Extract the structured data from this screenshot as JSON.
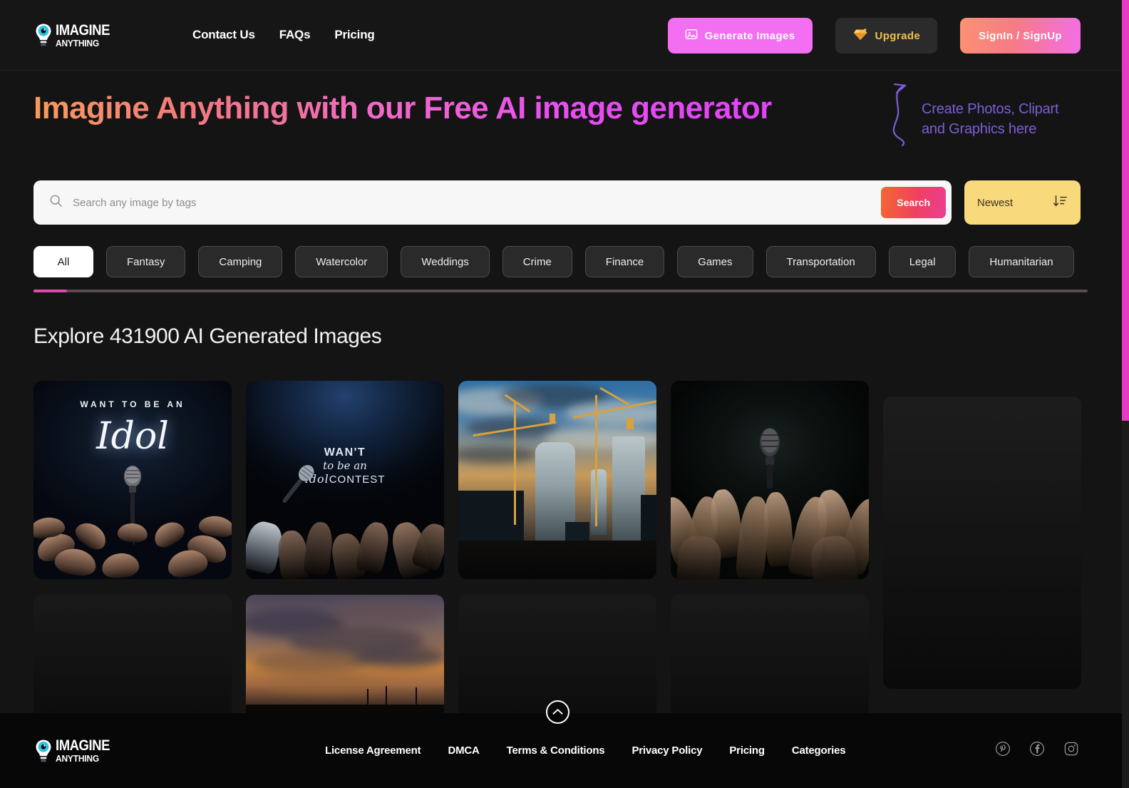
{
  "header": {
    "logo": {
      "line1": "IMAGINE",
      "line2": "ANYTHING",
      "icon": "lightbulb-eye-logo"
    },
    "nav": [
      {
        "label": "Contact Us"
      },
      {
        "label": "FAQs"
      },
      {
        "label": "Pricing"
      }
    ],
    "actions": {
      "generate_label": "Generate Images",
      "generate_icon": "image-icon",
      "upgrade_label": "Upgrade",
      "upgrade_icon": "diamond-icon",
      "signin_label": "SignIn / SignUp"
    }
  },
  "hero": {
    "title": "Imagine Anything with our Free AI image generator",
    "note": "Create Photos, Clipart and Graphics here",
    "arrow_icon": "curved-arrow-icon"
  },
  "search": {
    "placeholder": "Search any image by tags",
    "value": "",
    "search_label": "Search",
    "search_icon": "search-icon",
    "sort_value": "Newest",
    "sort_icon": "sort-descending-icon"
  },
  "categories": {
    "items": [
      {
        "label": "All",
        "active": true
      },
      {
        "label": "Fantasy",
        "active": false
      },
      {
        "label": "Camping",
        "active": false
      },
      {
        "label": "Watercolor",
        "active": false
      },
      {
        "label": "Weddings",
        "active": false
      },
      {
        "label": "Crime",
        "active": false
      },
      {
        "label": "Finance",
        "active": false
      },
      {
        "label": "Games",
        "active": false
      },
      {
        "label": "Transportation",
        "active": false
      },
      {
        "label": "Legal",
        "active": false
      },
      {
        "label": "Humanitarian",
        "active": false
      }
    ]
  },
  "gallery": {
    "heading": "Explore 431900 AI Generated Images",
    "items": [
      {
        "name": "idol-microphone-hands",
        "caption_top": "WANT TO BE AN",
        "caption_script": "Idol"
      },
      {
        "name": "idol-contest-crowd",
        "caption_1": "WAN'T",
        "caption_2": "to be an",
        "caption_3a": "idol",
        "caption_3b": "CONTEST"
      },
      {
        "name": "city-construction-cranes-sunset"
      },
      {
        "name": "crowd-hands-reaching-microphone"
      },
      {
        "name": "sunset-sky-clouds"
      }
    ]
  },
  "scroll_top": {
    "icon": "chevron-up-icon"
  },
  "footer": {
    "logo": {
      "line1": "IMAGINE",
      "line2": "ANYTHING"
    },
    "links": [
      {
        "label": "License Agreement"
      },
      {
        "label": "DMCA"
      },
      {
        "label": "Terms & Conditions"
      },
      {
        "label": "Privacy Policy"
      },
      {
        "label": "Pricing"
      },
      {
        "label": "Categories"
      }
    ],
    "socials": [
      {
        "name": "pinterest-icon"
      },
      {
        "name": "facebook-icon"
      },
      {
        "name": "instagram-icon"
      }
    ]
  },
  "colors": {
    "background": "#141414",
    "accent_pink": "#f46ef2",
    "accent_yellow": "#f8d97c",
    "accent_orange": "#f4682f",
    "accent_purple": "#7c5fd6",
    "scrollbar": "#e839c5"
  }
}
